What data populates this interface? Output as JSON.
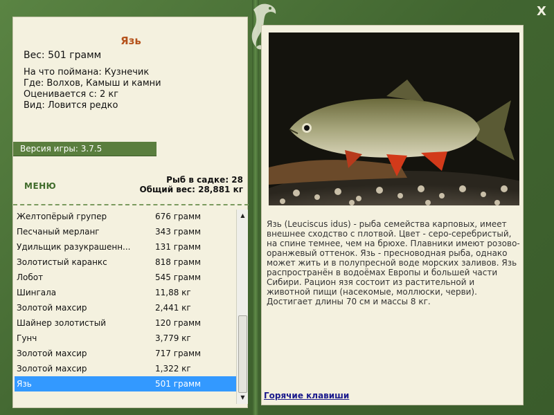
{
  "window": {
    "close_label": "X"
  },
  "fish_info": {
    "title": "Язь",
    "weight": "Вес: 501 грамм",
    "lines": [
      "На что поймана: Кузнечик",
      "Где: Волхов, Камыш и камни",
      "Оценивается с: 2 кг",
      "Вид: Ловится редко"
    ]
  },
  "version": "Версия игры: 3.7.5",
  "menu_label": "МЕНЮ",
  "stats": {
    "fish_in_cage": "Рыб в садке: 28",
    "total_weight": "Общий вес: 28,881 кг"
  },
  "fish_list": [
    {
      "name": "Желтопёрый групер",
      "weight": "676 грамм"
    },
    {
      "name": "Песчаный мерланг",
      "weight": "343 грамм"
    },
    {
      "name": "Удильщик разукрашенн...",
      "weight": "131 грамм"
    },
    {
      "name": "Золотистый каранкс",
      "weight": "818 грамм"
    },
    {
      "name": "Лобот",
      "weight": "545 грамм"
    },
    {
      "name": "Шингала",
      "weight": "11,88 кг"
    },
    {
      "name": "Золотой махсир",
      "weight": "2,441 кг"
    },
    {
      "name": "Шайнер золотистый",
      "weight": "120 грамм"
    },
    {
      "name": "Гунч",
      "weight": "3,779 кг"
    },
    {
      "name": "Золотой махсир",
      "weight": "717 грамм"
    },
    {
      "name": "Золотой махсир",
      "weight": "1,322 кг"
    },
    {
      "name": "Язь",
      "weight": "501 грамм",
      "selected": true
    }
  ],
  "description": "Язь (Leuciscus idus) - рыба семейства карповых, имеет внешнее сходство с плотвой. Цвет - серо-серебристый, на спине темнее, чем на брюхе. Плавники имеют розово-оранжевый оттенок. Язь - пресноводная рыба, однако может жить и в полупресной воде морских заливов. Язь распространён в водоёмах Европы и большей части Сибири. Рацион язя состоит из растительной и животной пищи (насекомые, моллюски, черви). Достигает длины 70 см и массы 8 кг.",
  "hotkeys_label": "Горячие клавиши",
  "icons": {
    "close": "close-icon",
    "logo": "fish-logo-icon",
    "scroll_up": "chevron-up-icon",
    "scroll_down": "chevron-down-icon"
  },
  "colors": {
    "frame": "#4b7138",
    "panel": "#f4f1df",
    "title": "#b5521b",
    "selection": "#3399ff",
    "link": "#1a1a8c"
  }
}
